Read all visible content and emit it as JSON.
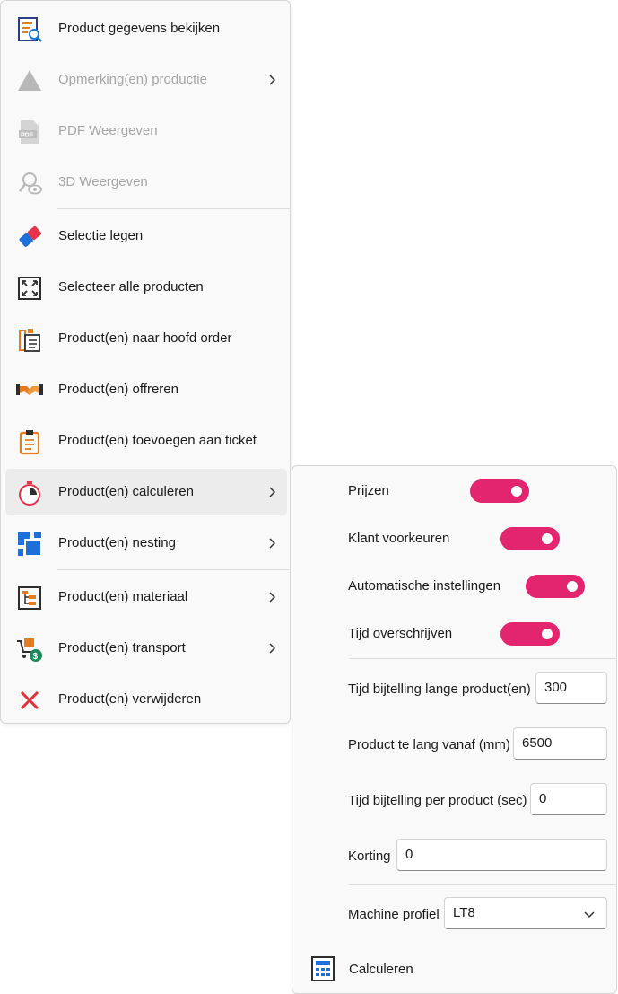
{
  "menu": {
    "items": [
      {
        "label": "Product gegevens bekijken",
        "icon": "document-search-icon",
        "disabled": false
      },
      {
        "label": "Opmerking(en) productie",
        "icon": "warning-triangle-icon",
        "disabled": true,
        "submenu": true
      },
      {
        "label": "PDF Weergeven",
        "icon": "pdf-icon",
        "disabled": true
      },
      {
        "label": "3D Weergeven",
        "icon": "eye-search-icon",
        "disabled": true
      },
      {
        "label": "Selectie legen",
        "icon": "eraser-icon",
        "disabled": false
      },
      {
        "label": "Selecteer alle producten",
        "icon": "select-all-icon",
        "disabled": false
      },
      {
        "label": "Product(en) naar hoofd order",
        "icon": "clipboard-copy-icon",
        "disabled": false
      },
      {
        "label": "Product(en) offreren",
        "icon": "handshake-icon",
        "disabled": false
      },
      {
        "label": "Product(en) toevoegen aan ticket",
        "icon": "clipboard-icon",
        "disabled": false
      },
      {
        "label": "Product(en) calculeren",
        "icon": "stopwatch-icon",
        "disabled": false,
        "submenu": true,
        "active": true
      },
      {
        "label": "Product(en) nesting",
        "icon": "nesting-icon",
        "disabled": false,
        "submenu": true
      },
      {
        "label": "Product(en) materiaal",
        "icon": "material-icon",
        "disabled": false,
        "submenu": true
      },
      {
        "label": "Product(en) transport",
        "icon": "cart-dollar-icon",
        "disabled": false,
        "submenu": true
      },
      {
        "label": "Product(en) verwijderen",
        "icon": "delete-x-icon",
        "disabled": false
      }
    ]
  },
  "calc_submenu": {
    "toggles": [
      {
        "label": "Prijzen",
        "on": true
      },
      {
        "label": "Klant voorkeuren",
        "on": true
      },
      {
        "label": "Automatische instellingen",
        "on": true
      },
      {
        "label": "Tijd overschrijven",
        "on": true
      }
    ],
    "fields": [
      {
        "label": "Tijd bijtelling lange product(en)",
        "value": "300"
      },
      {
        "label": "Product te lang vanaf (mm)",
        "value": "6500"
      },
      {
        "label": "Tijd bijtelling per product (sec)",
        "value": "0"
      },
      {
        "label": "Korting",
        "value": "0"
      }
    ],
    "machine": {
      "label": "Machine profiel",
      "value": "LT8"
    },
    "calculate_label": "Calculeren",
    "toggle_color": "#e3246f"
  }
}
